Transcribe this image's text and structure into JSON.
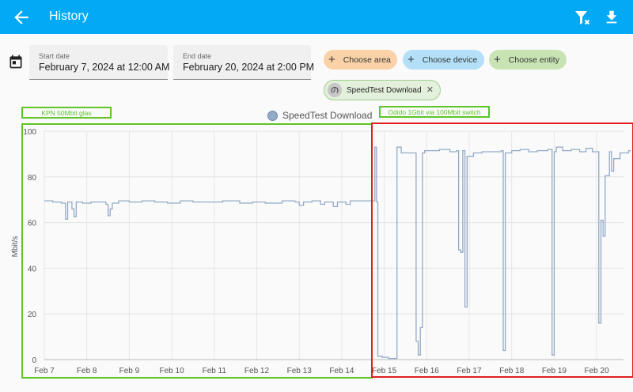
{
  "header": {
    "title": "History"
  },
  "date_range": {
    "start_label": "Start date",
    "start_value": "February 7, 2024 at 12:00 AM",
    "end_label": "End date",
    "end_value": "February 20, 2024 at 2:00 PM"
  },
  "target_pickers": [
    {
      "label": "Choose area",
      "color": "#fbd2a8"
    },
    {
      "label": "Choose device",
      "color": "#b3e0f8"
    },
    {
      "label": "Choose entity",
      "color": "#c9e4b4"
    }
  ],
  "selected_entity": {
    "label": "SpeedTest Download",
    "icon": "speedometer-icon"
  },
  "annotations": [
    {
      "label": "KPN 50Mbit glas",
      "color": "#5ec428"
    },
    {
      "label": "Odido 1Gbit via 100Mbit switch",
      "color": "#5ec428"
    }
  ],
  "colors": {
    "accent": "#03a9f4",
    "series": "#93aac8",
    "kpn_box": "#5ec428",
    "odido_box": "#e02020"
  },
  "chart_data": {
    "type": "line",
    "title": "",
    "legend": "SpeedTest Download",
    "legend_position": "top-center",
    "ylabel": "Mbit/s",
    "ylim": [
      0,
      100
    ],
    "yticks": [
      0,
      20,
      40,
      60,
      80,
      100
    ],
    "xtick_labels": [
      "Feb 7",
      "Feb 8",
      "Feb 9",
      "Feb 10",
      "Feb 11",
      "Feb 12",
      "Feb 13",
      "Feb 14",
      "Feb 15",
      "Feb 16",
      "Feb 17",
      "Feb 18",
      "Feb 19",
      "Feb 20"
    ],
    "grid": true,
    "step": true,
    "series": [
      {
        "name": "SpeedTest Download",
        "color": "#93aac8",
        "points": [
          [
            0.0,
            69.5
          ],
          [
            0.2,
            69.0
          ],
          [
            0.4,
            68.5
          ],
          [
            0.5,
            61.5
          ],
          [
            0.55,
            69.0
          ],
          [
            0.65,
            66.0
          ],
          [
            0.7,
            62.5
          ],
          [
            0.75,
            69.0
          ],
          [
            0.9,
            68.5
          ],
          [
            1.1,
            69.0
          ],
          [
            1.3,
            69.0
          ],
          [
            1.45,
            68.0
          ],
          [
            1.5,
            63.0
          ],
          [
            1.55,
            66.0
          ],
          [
            1.6,
            68.5
          ],
          [
            1.75,
            69.5
          ],
          [
            2.0,
            69.0
          ],
          [
            2.3,
            69.5
          ],
          [
            2.6,
            69.0
          ],
          [
            2.9,
            68.5
          ],
          [
            3.2,
            69.5
          ],
          [
            3.5,
            69.0
          ],
          [
            3.9,
            69.0
          ],
          [
            4.2,
            69.5
          ],
          [
            4.6,
            68.5
          ],
          [
            4.9,
            69.0
          ],
          [
            5.2,
            68.5
          ],
          [
            5.6,
            69.5
          ],
          [
            5.9,
            69.0
          ],
          [
            6.0,
            67.5
          ],
          [
            6.1,
            69.0
          ],
          [
            6.3,
            69.5
          ],
          [
            6.5,
            68.0
          ],
          [
            6.6,
            69.0
          ],
          [
            6.8,
            67.0
          ],
          [
            6.9,
            69.0
          ],
          [
            7.1,
            68.0
          ],
          [
            7.2,
            69.5
          ],
          [
            7.5,
            69.5
          ],
          [
            7.75,
            69.5
          ],
          [
            7.78,
            93.0
          ],
          [
            7.82,
            69.0
          ],
          [
            7.85,
            1.5
          ],
          [
            7.95,
            1.0
          ],
          [
            8.1,
            0.5
          ],
          [
            8.28,
            0.5
          ],
          [
            8.3,
            93.0
          ],
          [
            8.4,
            90.5
          ],
          [
            8.7,
            90.5
          ],
          [
            8.75,
            8.0
          ],
          [
            8.8,
            2.0
          ],
          [
            8.85,
            14.0
          ],
          [
            8.9,
            90.5
          ],
          [
            8.95,
            91.5
          ],
          [
            9.1,
            91.5
          ],
          [
            9.3,
            92.0
          ],
          [
            9.55,
            91.0
          ],
          [
            9.7,
            91.5
          ],
          [
            9.75,
            48.0
          ],
          [
            9.8,
            47.0
          ],
          [
            9.85,
            91.5
          ],
          [
            9.9,
            23.0
          ],
          [
            9.95,
            89.0
          ],
          [
            10.1,
            90.5
          ],
          [
            10.3,
            91.0
          ],
          [
            10.55,
            91.0
          ],
          [
            10.75,
            91.5
          ],
          [
            10.8,
            4.0
          ],
          [
            10.85,
            90.5
          ],
          [
            11.0,
            91.5
          ],
          [
            11.2,
            92.0
          ],
          [
            11.4,
            91.0
          ],
          [
            11.6,
            91.5
          ],
          [
            11.85,
            92.0
          ],
          [
            11.95,
            2.0
          ],
          [
            12.0,
            91.0
          ],
          [
            12.05,
            93.0
          ],
          [
            12.2,
            91.5
          ],
          [
            12.4,
            92.0
          ],
          [
            12.6,
            91.0
          ],
          [
            12.75,
            92.5
          ],
          [
            12.9,
            91.0
          ],
          [
            13.05,
            16.0
          ],
          [
            13.1,
            61.0
          ],
          [
            13.15,
            54.0
          ],
          [
            13.2,
            80.5
          ],
          [
            13.3,
            91.0
          ],
          [
            13.35,
            82.5
          ],
          [
            13.4,
            88.0
          ],
          [
            13.55,
            90.5
          ],
          [
            13.75,
            91.5
          ],
          [
            13.8,
            91.5
          ]
        ]
      }
    ]
  }
}
